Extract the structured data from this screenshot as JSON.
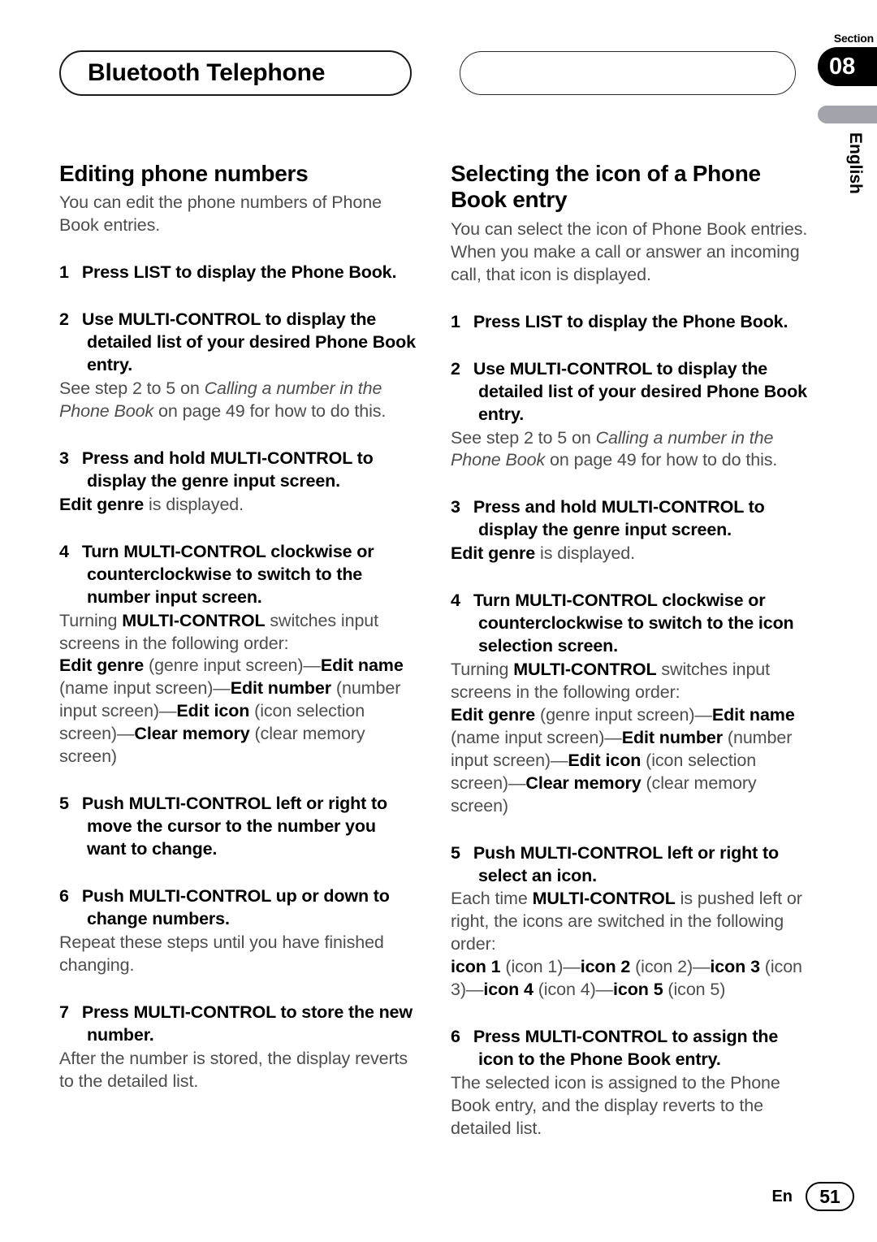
{
  "header": {
    "title": "Bluetooth Telephone",
    "blank_pill_text": "",
    "section_label": "Section",
    "section_number": "08",
    "language": "English"
  },
  "footer": {
    "lang_code": "En",
    "page_number": "51"
  },
  "columns": {
    "left": {
      "heading": "Editing phone numbers",
      "intro": "You can edit the phone numbers of Phone Book entries.",
      "steps": [
        {
          "num": "1",
          "head": "Press LIST to display the Phone Book.",
          "body_parts": []
        },
        {
          "num": "2",
          "head": "Use MULTI-CONTROL to display the detailed list of your desired Phone Book entry.",
          "body_parts": [
            {
              "text": "See step 2 to 5 on ",
              "style": "plain"
            },
            {
              "text": "Calling a number in the Phone Book",
              "style": "italic"
            },
            {
              "text": " on page 49 for how to do this.",
              "style": "plain"
            }
          ]
        },
        {
          "num": "3",
          "head": "Press and hold MULTI-CONTROL to display the genre input screen.",
          "body_parts": [
            {
              "text": "Edit genre",
              "style": "bold"
            },
            {
              "text": " is displayed.",
              "style": "plain"
            }
          ]
        },
        {
          "num": "4",
          "head": "Turn MULTI-CONTROL clockwise or counterclockwise to switch to the number input screen.",
          "body_parts": [
            {
              "text": "Turning ",
              "style": "plain"
            },
            {
              "text": "MULTI-CONTROL",
              "style": "bold"
            },
            {
              "text": " switches input screens in the following order:",
              "style": "plain"
            },
            {
              "text": "\n",
              "style": "break"
            },
            {
              "text": "Edit genre",
              "style": "bold"
            },
            {
              "text": " (genre input screen)—",
              "style": "plain"
            },
            {
              "text": "Edit name",
              "style": "bold"
            },
            {
              "text": " (name input screen)—",
              "style": "plain"
            },
            {
              "text": "Edit number",
              "style": "bold"
            },
            {
              "text": " (number input screen)—",
              "style": "plain"
            },
            {
              "text": "Edit icon",
              "style": "bold"
            },
            {
              "text": " (icon selection screen)—",
              "style": "plain"
            },
            {
              "text": "Clear memory",
              "style": "bold"
            },
            {
              "text": " (clear memory screen)",
              "style": "plain"
            }
          ]
        },
        {
          "num": "5",
          "head": "Push MULTI-CONTROL left or right to move the cursor to the number you want to change.",
          "body_parts": []
        },
        {
          "num": "6",
          "head": "Push MULTI-CONTROL up or down to change numbers.",
          "body_parts": [
            {
              "text": "Repeat these steps until you have finished changing.",
              "style": "plain"
            }
          ]
        },
        {
          "num": "7",
          "head": "Press MULTI-CONTROL to store the new number.",
          "body_parts": [
            {
              "text": "After the number is stored, the display reverts to the detailed list.",
              "style": "plain"
            }
          ]
        }
      ]
    },
    "right": {
      "heading": "Selecting the icon of a Phone Book entry",
      "intro": "You can select the icon of Phone Book entries. When you make a call or answer an incoming call, that icon is displayed.",
      "steps": [
        {
          "num": "1",
          "head": "Press LIST to display the Phone Book.",
          "body_parts": []
        },
        {
          "num": "2",
          "head": "Use MULTI-CONTROL to display the detailed list of your desired Phone Book entry.",
          "body_parts": [
            {
              "text": "See step 2 to 5 on ",
              "style": "plain"
            },
            {
              "text": "Calling a number in the Phone Book",
              "style": "italic"
            },
            {
              "text": " on page 49 for how to do this.",
              "style": "plain"
            }
          ]
        },
        {
          "num": "3",
          "head": "Press and hold MULTI-CONTROL to display the genre input screen.",
          "body_parts": [
            {
              "text": "Edit genre",
              "style": "bold"
            },
            {
              "text": " is displayed.",
              "style": "plain"
            }
          ]
        },
        {
          "num": "4",
          "head": "Turn MULTI-CONTROL clockwise or counterclockwise to switch to the icon selection screen.",
          "body_parts": [
            {
              "text": "Turning ",
              "style": "plain"
            },
            {
              "text": "MULTI-CONTROL",
              "style": "bold"
            },
            {
              "text": " switches input screens in the following order:",
              "style": "plain"
            },
            {
              "text": "\n",
              "style": "break"
            },
            {
              "text": "Edit genre",
              "style": "bold"
            },
            {
              "text": " (genre input screen)—",
              "style": "plain"
            },
            {
              "text": "Edit name",
              "style": "bold"
            },
            {
              "text": " (name input screen)—",
              "style": "plain"
            },
            {
              "text": "Edit number",
              "style": "bold"
            },
            {
              "text": " (number input screen)—",
              "style": "plain"
            },
            {
              "text": "Edit icon",
              "style": "bold"
            },
            {
              "text": " (icon selection screen)—",
              "style": "plain"
            },
            {
              "text": "Clear memory",
              "style": "bold"
            },
            {
              "text": " (clear memory screen)",
              "style": "plain"
            }
          ]
        },
        {
          "num": "5",
          "head": "Push MULTI-CONTROL left or right to select an icon.",
          "body_parts": [
            {
              "text": "Each time ",
              "style": "plain"
            },
            {
              "text": "MULTI-CONTROL",
              "style": "bold"
            },
            {
              "text": " is pushed left or right, the icons are switched in the following order:",
              "style": "plain"
            },
            {
              "text": "\n",
              "style": "break"
            },
            {
              "text": "icon 1",
              "style": "bold"
            },
            {
              "text": " (icon 1)—",
              "style": "plain"
            },
            {
              "text": "icon 2",
              "style": "bold"
            },
            {
              "text": " (icon 2)—",
              "style": "plain"
            },
            {
              "text": "icon 3",
              "style": "bold"
            },
            {
              "text": " (icon 3)—",
              "style": "plain"
            },
            {
              "text": "icon 4",
              "style": "bold"
            },
            {
              "text": " (icon 4)—",
              "style": "plain"
            },
            {
              "text": "icon 5",
              "style": "bold"
            },
            {
              "text": " (icon 5)",
              "style": "plain"
            }
          ]
        },
        {
          "num": "6",
          "head": "Press MULTI-CONTROL to assign the icon to the Phone Book entry.",
          "body_parts": [
            {
              "text": "The selected icon is assigned to the Phone Book entry, and the display reverts to the detailed list.",
              "style": "plain"
            }
          ]
        }
      ]
    }
  }
}
